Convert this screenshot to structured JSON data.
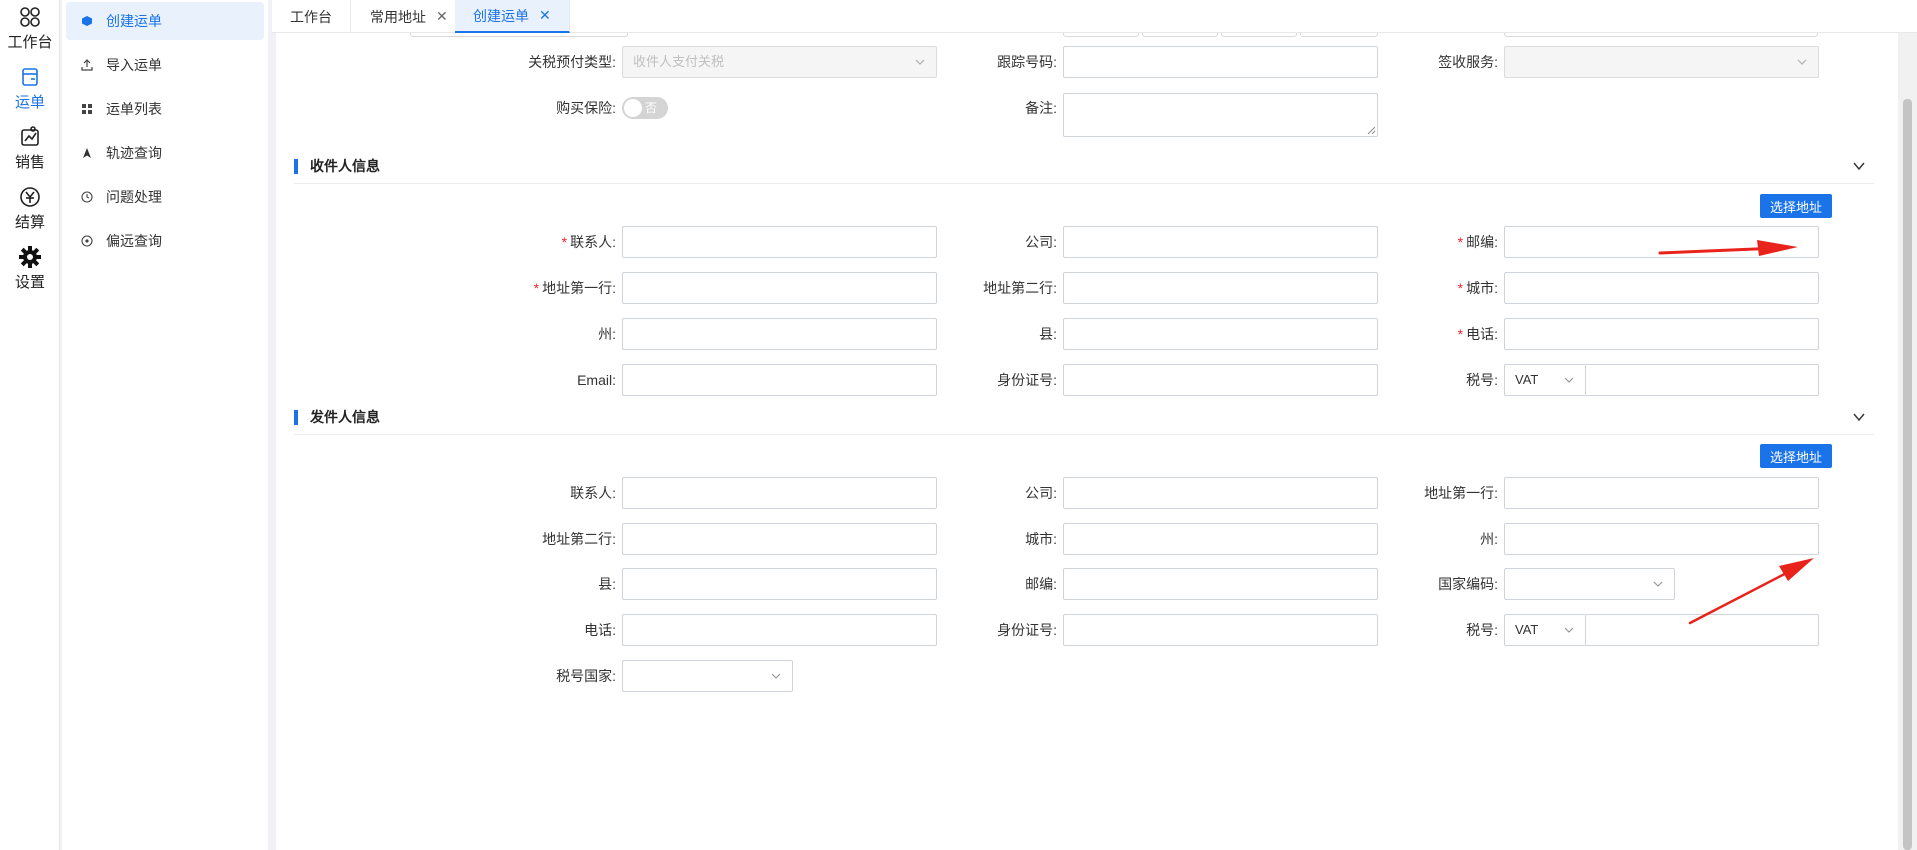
{
  "rail": {
    "items": [
      {
        "label": "工作台",
        "icon": "workbench-icon"
      },
      {
        "label": "运单",
        "icon": "waybill-icon"
      },
      {
        "label": "销售",
        "icon": "sales-icon"
      },
      {
        "label": "结算",
        "icon": "settlement-icon"
      },
      {
        "label": "设置",
        "icon": "gear-icon"
      }
    ],
    "active_color": "#1a73e8"
  },
  "menu": {
    "items": [
      {
        "label": "创建运单",
        "icon": "box-icon"
      },
      {
        "label": "导入运单",
        "icon": "upload-icon"
      },
      {
        "label": "运单列表",
        "icon": "grid-icon"
      },
      {
        "label": "轨迹查询",
        "icon": "navigation-icon"
      },
      {
        "label": "问题处理",
        "icon": "clock-icon"
      },
      {
        "label": "偏远查询",
        "icon": "target-icon"
      }
    ]
  },
  "tabs": [
    {
      "label": "工作台"
    },
    {
      "label": "常用地址"
    },
    {
      "label": "创建运单"
    }
  ],
  "top_form": {
    "tax_type_label": "关税预付类型:",
    "tax_type_value": "收件人支付关税",
    "tracking_label": "跟踪号码:",
    "sign_label": "签收服务:",
    "insurance_label": "购买保险:",
    "insurance_toggle_text": "否",
    "remark_label": "备注:"
  },
  "receiver": {
    "title": "收件人信息",
    "select_button": "选择地址",
    "fields": {
      "contact": "联系人:",
      "company": "公司:",
      "postcode": "邮编:",
      "address1": "地址第一行:",
      "address2": "地址第二行:",
      "city": "城市:",
      "state": "州:",
      "county": "县:",
      "phone": "电话:",
      "email": "Email:",
      "id_number": "身份证号:",
      "tax_no": "税号:",
      "tax_type": "VAT"
    }
  },
  "sender": {
    "title": "发件人信息",
    "select_button": "选择地址",
    "fields": {
      "contact": "联系人:",
      "company": "公司:",
      "address1": "地址第一行:",
      "address2": "地址第二行:",
      "city": "城市:",
      "state": "州:",
      "county": "县:",
      "postcode": "邮编:",
      "country_code": "国家编码:",
      "phone": "电话:",
      "id_number": "身份证号:",
      "tax_no": "税号:",
      "tax_type": "VAT",
      "tax_country": "税号国家:"
    }
  },
  "colors": {
    "primary": "#1a73e8",
    "required": "#f5222d",
    "annotation_arrow": "#e8231c"
  }
}
